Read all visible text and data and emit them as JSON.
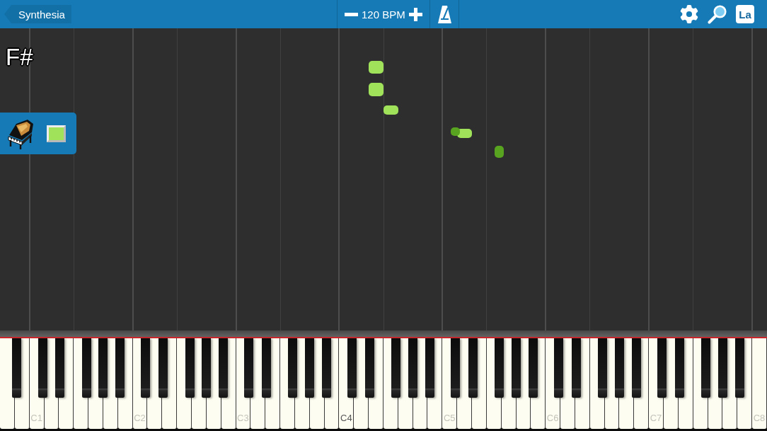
{
  "top_bar": {
    "back_button": {
      "label": "Synthesia"
    },
    "tempo": {
      "reading": "120 BPM"
    },
    "labels_button": {
      "label": "La"
    }
  },
  "note_label": "F#",
  "tracks": [
    {
      "color": "#a0e35a"
    }
  ],
  "keyboard": {
    "octave_labels": [
      {
        "text": "C1",
        "highlighted": false
      },
      {
        "text": "C2",
        "highlighted": false
      },
      {
        "text": "C3",
        "highlighted": false
      },
      {
        "text": "C4",
        "highlighted": true
      },
      {
        "text": "C5",
        "highlighted": false
      },
      {
        "text": "C6",
        "highlighted": false
      },
      {
        "text": "C7",
        "highlighted": false
      },
      {
        "text": "C8",
        "highlighted": false
      }
    ]
  }
}
